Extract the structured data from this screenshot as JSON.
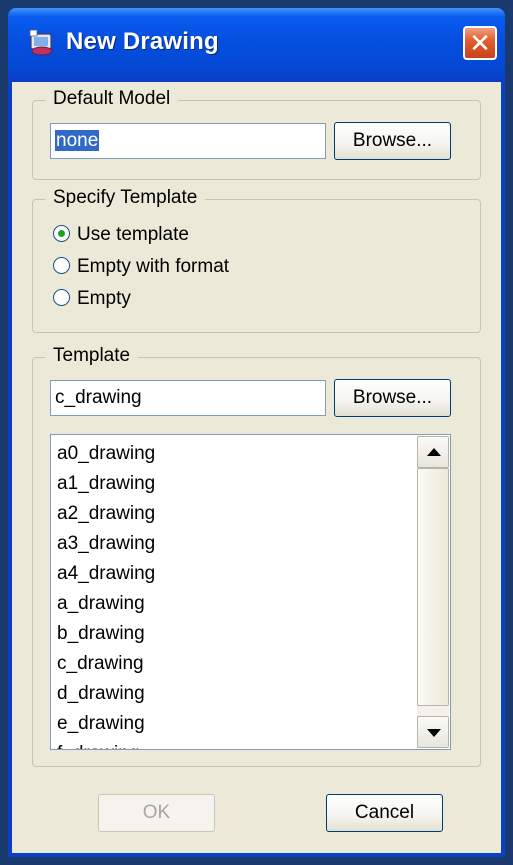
{
  "window": {
    "title": "New Drawing",
    "close_label": "✕"
  },
  "default_model": {
    "legend": "Default Model",
    "value": "none",
    "browse_label": "Browse..."
  },
  "specify_template": {
    "legend": "Specify Template",
    "options": [
      {
        "label": "Use template",
        "selected": true
      },
      {
        "label": "Empty with format",
        "selected": false
      },
      {
        "label": "Empty",
        "selected": false
      }
    ]
  },
  "template": {
    "legend": "Template",
    "value": "c_drawing",
    "browse_label": "Browse...",
    "items": [
      "a0_drawing",
      "a1_drawing",
      "a2_drawing",
      "a3_drawing",
      "a4_drawing",
      "a_drawing",
      "b_drawing",
      "c_drawing",
      "d_drawing",
      "e_drawing",
      "f_drawing"
    ],
    "scroll_position": 0.95
  },
  "buttons": {
    "ok_label": "OK",
    "cancel_label": "Cancel",
    "ok_enabled": false
  }
}
